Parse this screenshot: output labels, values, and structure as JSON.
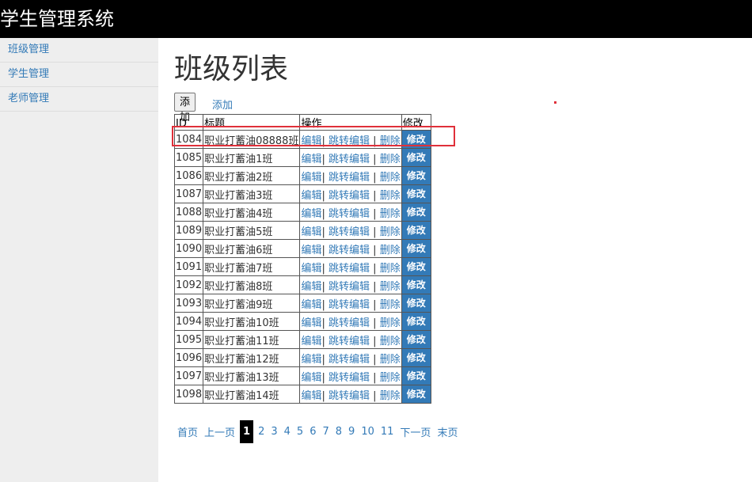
{
  "app": {
    "title": "学生管理系统"
  },
  "sidebar": {
    "items": [
      {
        "label": "班级管理"
      },
      {
        "label": "学生管理"
      },
      {
        "label": "老师管理"
      }
    ]
  },
  "main": {
    "title": "班级列表",
    "add_button": "添加",
    "add_link": "添加"
  },
  "table": {
    "headers": {
      "id": "ID",
      "title": "标题",
      "ops": "操作",
      "edit": "修改"
    },
    "op_labels": {
      "edit": "编辑",
      "jump_edit": "跳转编辑",
      "delete": "删除",
      "sep1": "|",
      "sep2": "|",
      "modify": "修改"
    },
    "rows": [
      {
        "id": "1084",
        "title": "职业打蓄油08888班"
      },
      {
        "id": "1085",
        "title": "职业打蓄油1班"
      },
      {
        "id": "1086",
        "title": "职业打蓄油2班"
      },
      {
        "id": "1087",
        "title": "职业打蓄油3班"
      },
      {
        "id": "1088",
        "title": "职业打蓄油4班"
      },
      {
        "id": "1089",
        "title": "职业打蓄油5班"
      },
      {
        "id": "1090",
        "title": "职业打蓄油6班"
      },
      {
        "id": "1091",
        "title": "职业打蓄油7班"
      },
      {
        "id": "1092",
        "title": "职业打蓄油8班"
      },
      {
        "id": "1093",
        "title": "职业打蓄油9班"
      },
      {
        "id": "1094",
        "title": "职业打蓄油10班"
      },
      {
        "id": "1095",
        "title": "职业打蓄油11班"
      },
      {
        "id": "1096",
        "title": "职业打蓄油12班"
      },
      {
        "id": "1097",
        "title": "职业打蓄油13班"
      },
      {
        "id": "1098",
        "title": "职业打蓄油14班"
      }
    ]
  },
  "pagination": {
    "first": "首页",
    "prev": "上一页",
    "current": "1",
    "pages": [
      "2",
      "3",
      "4",
      "5",
      "6",
      "7",
      "8",
      "9",
      "10",
      "11"
    ],
    "next": "下一页",
    "last": "末页"
  },
  "colors": {
    "link": "#337ab7",
    "highlight": "#e0303a",
    "topbar": "#000000",
    "sidebar": "#eeeeee"
  }
}
